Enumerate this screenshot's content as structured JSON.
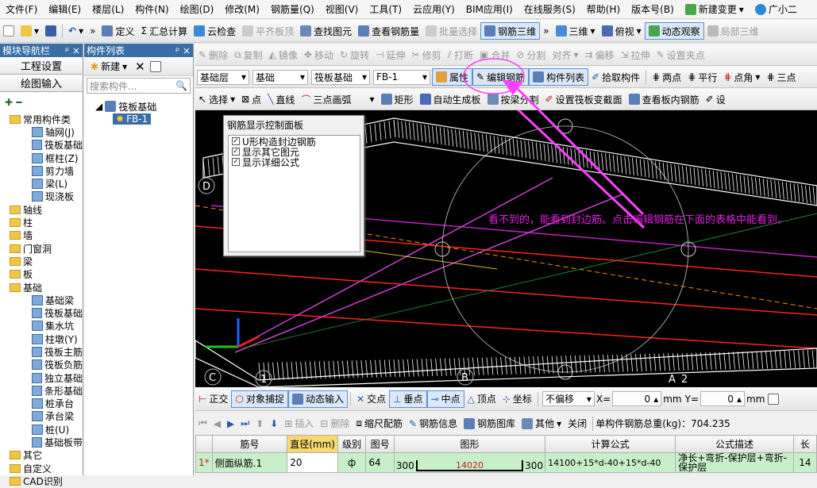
{
  "menu": [
    "文件(F)",
    "编辑(E)",
    "楼层(L)",
    "构件(N)",
    "绘图(D)",
    "修改(M)",
    "钢筋量(Q)",
    "视图(V)",
    "工具(T)",
    "云应用(Y)",
    "BIM应用(I)",
    "在线服务(S)",
    "帮助(H)",
    "版本号(B)",
    "新建变更",
    "广小二"
  ],
  "toolbar1": {
    "define": "定义",
    "sum": "汇总计算",
    "cloud_check": "云检查",
    "flat_top": "平齐板顶",
    "find": "查找图元",
    "view_rebar": "查看钢筋量",
    "batch": "批量选择",
    "rebar3d": "钢筋三维",
    "threed": "三维",
    "topview": "俯视",
    "dynamic": "动态观察",
    "local3d": "局部三维"
  },
  "left_panel": {
    "title": "模块导航栏",
    "pin": "ᵖ",
    "close": "×",
    "sect1": "工程设置",
    "sect2": "绘图输入",
    "tree": [
      {
        "label": "常用构件类",
        "lvl": 0,
        "t": "folder"
      },
      {
        "label": "轴网(J)",
        "lvl": 1,
        "t": "leaf"
      },
      {
        "label": "筏板基础",
        "lvl": 1,
        "t": "leaf"
      },
      {
        "label": "框柱(Z)",
        "lvl": 1,
        "t": "leaf"
      },
      {
        "label": "剪力墙",
        "lvl": 1,
        "t": "leaf"
      },
      {
        "label": "梁(L)",
        "lvl": 1,
        "t": "leaf"
      },
      {
        "label": "现浇板",
        "lvl": 1,
        "t": "leaf"
      },
      {
        "label": "轴线",
        "lvl": 0,
        "t": "folder"
      },
      {
        "label": "柱",
        "lvl": 0,
        "t": "folder"
      },
      {
        "label": "墙",
        "lvl": 0,
        "t": "folder"
      },
      {
        "label": "门窗洞",
        "lvl": 0,
        "t": "folder"
      },
      {
        "label": "梁",
        "lvl": 0,
        "t": "folder"
      },
      {
        "label": "板",
        "lvl": 0,
        "t": "folder"
      },
      {
        "label": "基础",
        "lvl": 0,
        "t": "folder"
      },
      {
        "label": "基础梁",
        "lvl": 1,
        "t": "leaf"
      },
      {
        "label": "筏板基础",
        "lvl": 1,
        "t": "leaf"
      },
      {
        "label": "集水坑",
        "lvl": 1,
        "t": "leaf"
      },
      {
        "label": "柱墩(Y)",
        "lvl": 1,
        "t": "leaf"
      },
      {
        "label": "筏板主筋",
        "lvl": 1,
        "t": "leaf"
      },
      {
        "label": "筏板负筋",
        "lvl": 1,
        "t": "leaf"
      },
      {
        "label": "独立基础",
        "lvl": 1,
        "t": "leaf"
      },
      {
        "label": "条形基础",
        "lvl": 1,
        "t": "leaf"
      },
      {
        "label": "桩承台",
        "lvl": 1,
        "t": "leaf"
      },
      {
        "label": "承台梁",
        "lvl": 1,
        "t": "leaf"
      },
      {
        "label": "桩(U)",
        "lvl": 1,
        "t": "leaf"
      },
      {
        "label": "基础板带",
        "lvl": 1,
        "t": "leaf"
      },
      {
        "label": "其它",
        "lvl": 0,
        "t": "folder"
      },
      {
        "label": "自定义",
        "lvl": 0,
        "t": "folder"
      },
      {
        "label": "CAD识别",
        "lvl": 0,
        "t": "folder"
      }
    ]
  },
  "comp_panel": {
    "title": "构件列表",
    "new": "新建",
    "search_placeholder": "搜索构件...",
    "root": "筏板基础",
    "child": "FB-1"
  },
  "edit_toolbar": {
    "delete": "删除",
    "copy": "复制",
    "mirror": "镜像",
    "move": "移动",
    "rotate": "旋转",
    "extend": "延伸",
    "trim": "修剪",
    "break": "打断",
    "merge": "合并",
    "split": "分割",
    "align": "对齐",
    "offset": "偏移",
    "stretch": "拉伸",
    "set_point": "设置夹点"
  },
  "prop_toolbar": {
    "floor": "基础层",
    "type": "基础",
    "category": "筏板基础",
    "item": "FB-1",
    "props": "属性",
    "edit_rebar": "编辑钢筋",
    "comp_list": "构件列表",
    "pick": "拾取构件",
    "twopoint": "两点",
    "parallel": "平行",
    "pointangle": "点角",
    "threepoint": "三点"
  },
  "draw_toolbar": {
    "select": "选择",
    "point": "点",
    "line": "直线",
    "arc": "三点画弧",
    "rect": "矩形",
    "auto": "自动生成板",
    "split_axis": "按梁分割",
    "set_slope": "设置筏板变截面",
    "view_inner": "查看板内钢筋",
    "set": "设"
  },
  "ctrl_panel": {
    "title": "钢筋显示控制面板",
    "items": [
      "U形构造封边钢筋",
      "显示其它图元",
      "显示详细公式"
    ]
  },
  "annotation": "看不到的，能看到封边筋。点击编辑钢筋在下面的表格中能看到。",
  "viewport": {
    "axis_labels": [
      "D",
      "C",
      "1",
      "B",
      "A",
      "2"
    ],
    "scale": "2400"
  },
  "snap_bar": {
    "ortho": "正交",
    "snap": "对象捕捉",
    "dyn_input": "动态输入",
    "intersect": "交点",
    "perp": "垂点",
    "mid": "中点",
    "vertex": "顶点",
    "coord": "坐标",
    "nooffset": "不偏移",
    "x_label": "X=",
    "x_val": "0",
    "y_label": "Y=",
    "y_val": "0",
    "unit": "mm"
  },
  "grid_bar": {
    "insert": "插入",
    "delete": "删除",
    "scale_rebar": "缩尺配筋",
    "rebar_info": "钢筋信息",
    "rebar_lib": "钢筋图库",
    "other": "其他",
    "close": "关闭",
    "total": "单构件钢筋总重(kg)：704.235"
  },
  "table": {
    "headers": [
      "筋号",
      "直径(mm)",
      "级别",
      "图号",
      "图形",
      "计算公式",
      "公式描述",
      "长"
    ],
    "rows": [
      {
        "no": "1*",
        "name": "侧面纵筋.1",
        "dia": "20",
        "grade": "ф",
        "fig": "64",
        "left": "300",
        "mid": "14020",
        "right": "300",
        "formula": "14100+15*d-40+15*d-40",
        "desc": "净长+弯折-保护层+弯折-保护层",
        "len": "14"
      }
    ]
  },
  "colors": {
    "accent": "#e020e0",
    "title_blue": "#3a6ea5"
  }
}
